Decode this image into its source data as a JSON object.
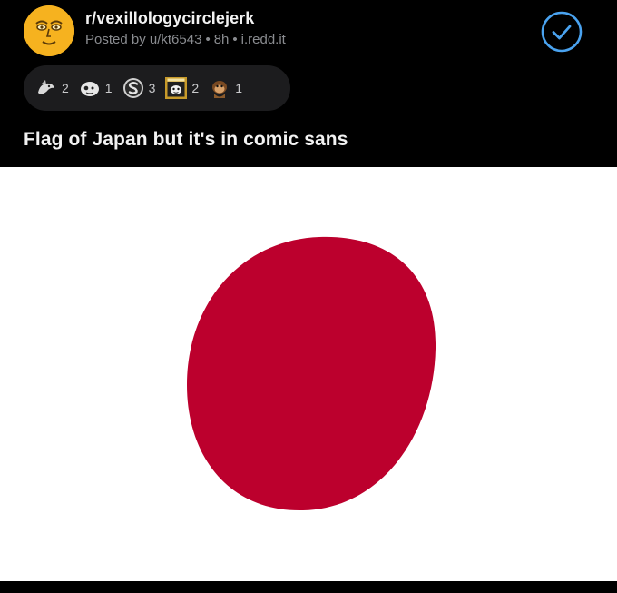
{
  "post": {
    "subreddit": "r/vexillologycirclejerk",
    "posted_by": "Posted by u/kt6543",
    "time": "8h",
    "domain": "i.redd.it",
    "title": "Flag of Japan but it's in comic sans"
  },
  "awards": [
    {
      "icon": "wholesome-seal-icon",
      "count": "2"
    },
    {
      "icon": "ghost-face-icon",
      "count": "1"
    },
    {
      "icon": "silver-s-icon",
      "count": "3"
    },
    {
      "icon": "take-my-energy-icon",
      "count": "2"
    },
    {
      "icon": "monkey-icon",
      "count": "1"
    }
  ],
  "colors": {
    "background": "#000000",
    "flag_white": "#ffffff",
    "flag_red": "#bc002d",
    "accent_blue": "#4aa3f0",
    "avatar": "#f6b21f"
  }
}
